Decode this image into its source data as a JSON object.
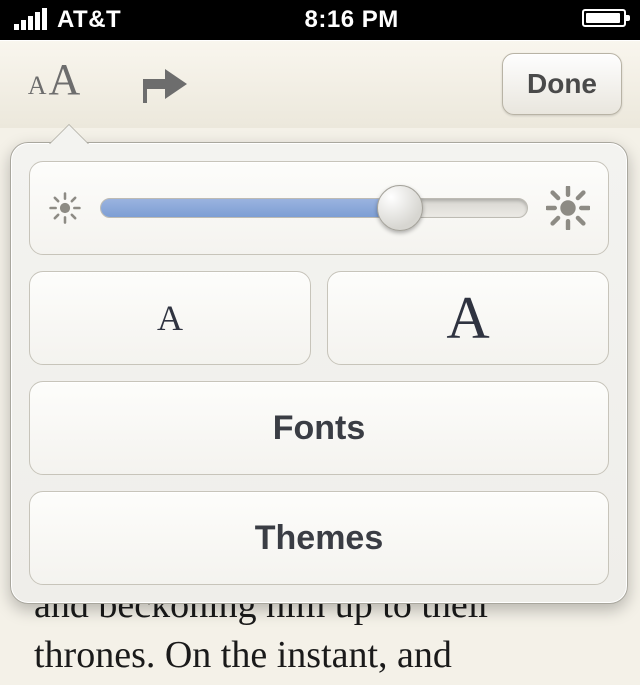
{
  "status": {
    "carrier": "AT&T",
    "time": "8:16 PM"
  },
  "toolbar": {
    "text_size_small": "A",
    "text_size_big": "A",
    "done_label": "Done"
  },
  "popover": {
    "decrease_label": "A",
    "increase_label": "A",
    "fonts_label": "Fonts",
    "themes_label": "Themes",
    "brightness_value": 70
  },
  "page": {
    "visible_text": "and beckoning him up to their thrones. On the instant, and"
  }
}
